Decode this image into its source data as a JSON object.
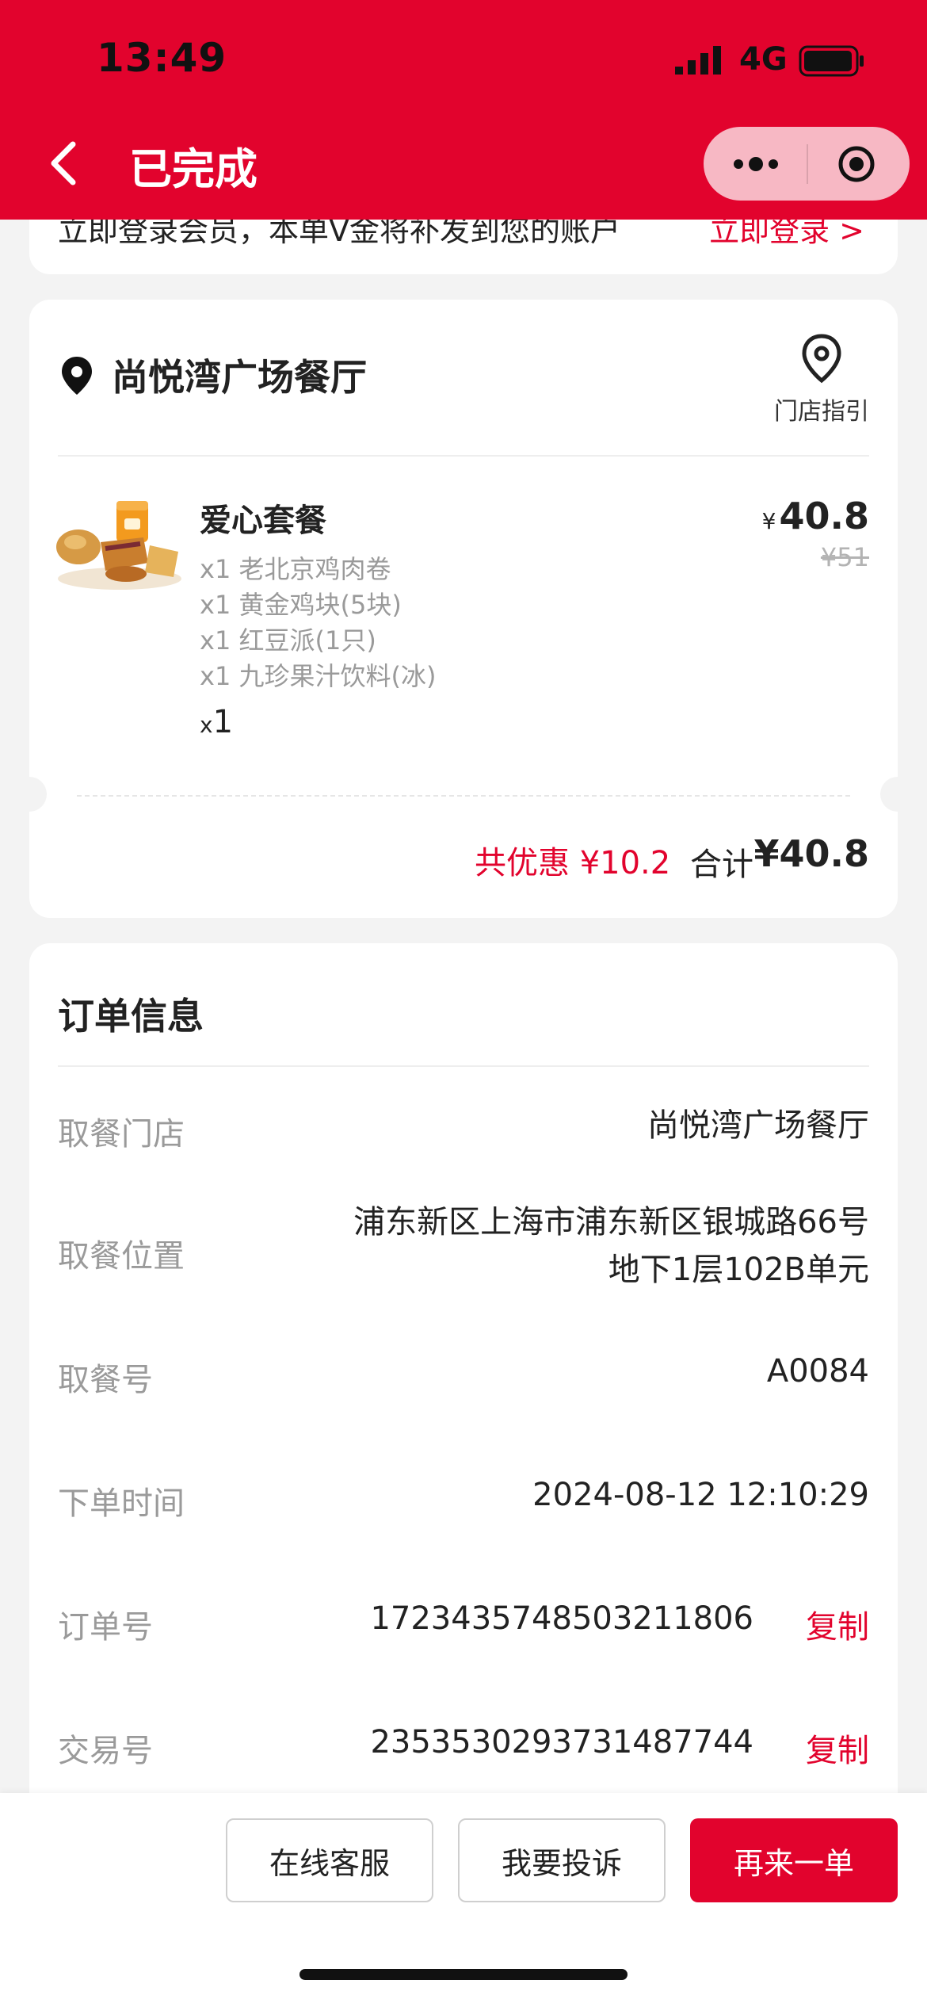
{
  "status_bar": {
    "time": "13:49",
    "network": "4G"
  },
  "nav": {
    "title": "已完成"
  },
  "login_banner": {
    "text": "立即登录会员，本单V金将补发到您的账户",
    "link": "立即登录 >"
  },
  "store": {
    "name": "尚悦湾广场餐厅",
    "guide_label": "门店指引"
  },
  "order_item": {
    "name": "爱心套餐",
    "components": [
      "x1 老北京鸡肉卷",
      "x1 黄金鸡块(5块)",
      "x1 红豆派(1只)",
      "x1 九珍果汁饮料(冰)"
    ],
    "qty_prefix": "x",
    "qty": "1",
    "currency": "¥",
    "price": "40.8",
    "original_price": "¥51"
  },
  "summary": {
    "discount": "共优惠 ¥10.2",
    "total_label": "合计",
    "total_value": "¥40.8"
  },
  "order_info": {
    "title": "订单信息",
    "rows": [
      {
        "label": "取餐门店",
        "value": "尚悦湾广场餐厅"
      },
      {
        "label": "取餐位置",
        "value_line1": "浦东新区上海市浦东新区银城路66号",
        "value_line2": "地下1层102B单元"
      },
      {
        "label": "取餐号",
        "value": "A0084"
      },
      {
        "label": "下单时间",
        "value": "2024-08-12 12:10:29"
      },
      {
        "label": "订单号",
        "value": "1723435748503211806",
        "action": "复制"
      },
      {
        "label": "交易号",
        "value": "2353530293731487744",
        "action": "复制"
      }
    ]
  },
  "actions": {
    "service": "在线客服",
    "complain": "我要投诉",
    "reorder": "再来一单"
  },
  "colors": {
    "brand_red": "#e2032d",
    "muted": "#9a9a9a"
  },
  "icons": [
    "back-arrow-icon",
    "more-dots-icon",
    "target-icon",
    "location-pin-icon",
    "map-pin-outline-icon",
    "signal-icon",
    "battery-icon"
  ]
}
